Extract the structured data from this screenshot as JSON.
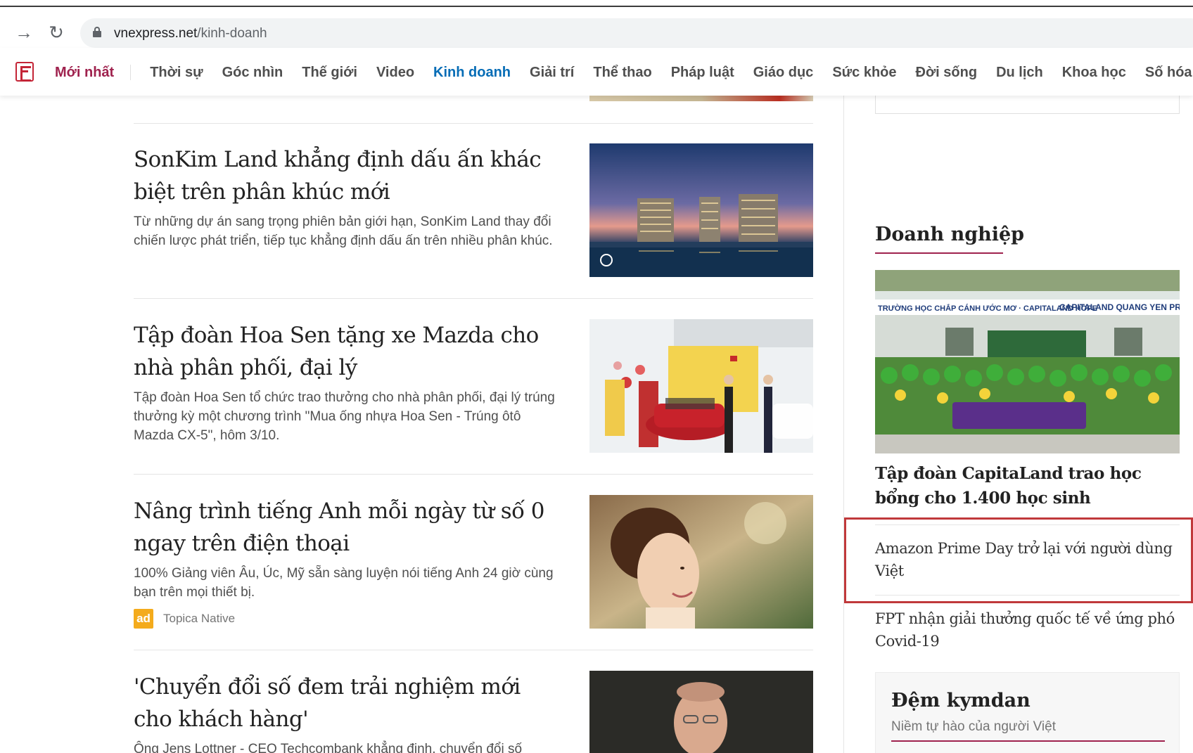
{
  "browser": {
    "url_domain": "vnexpress.net",
    "url_path": "/kinh-doanh"
  },
  "nav": {
    "latest": "Mới nhất",
    "items": [
      "Thời sự",
      "Góc nhìn",
      "Thế giới",
      "Video",
      "Kinh doanh",
      "Giải trí",
      "Thể thao",
      "Pháp luật",
      "Giáo dục",
      "Sức khỏe",
      "Đời sống",
      "Du lịch",
      "Khoa học",
      "Số hóa"
    ],
    "active_item": "Kinh doanh"
  },
  "articles": [
    {
      "title": "SonKim Land khẳng định dấu ấn khác biệt trên phân khúc mới",
      "description": "Từ những dự án sang trọng phiên bản giới hạn, SonKim Land thay đổi chiến lược phát triển, tiếp tục khẳng định dấu ấn trên nhiều phân khúc."
    },
    {
      "title": "Tập đoàn Hoa Sen tặng xe Mazda cho nhà phân phối, đại lý",
      "description": "Tập đoàn Hoa Sen tổ chức trao thưởng cho nhà phân phối, đại lý trúng thưởng kỳ một chương trình \"Mua ống nhựa Hoa Sen - Trúng ôtô Mazda CX-5\", hôm 3/10."
    },
    {
      "title": "Nâng trình tiếng Anh mỗi ngày từ số 0 ngay trên điện thoại",
      "description": "100% Giảng viên Âu, Úc, Mỹ sẵn sàng luyện nói tiếng Anh 24 giờ cùng bạn trên mọi thiết bị.",
      "ad_badge": "ad",
      "ad_source": "Topica Native"
    },
    {
      "title": "'Chuyển đổi số đem trải nghiệm mới cho khách hàng'",
      "description": "Ông Jens Lottner - CEO Techcombank khẳng định, chuyển đổi số"
    }
  ],
  "sidebar": {
    "heading": "Doanh nghiệp",
    "photo_banner_left": "TRƯỜNG HỌC CHẮP CÁNH ƯỚC MƠ · CAPITALAND HOPE",
    "photo_banner_right": "CAPITALAND QUANG YEN PRIM",
    "main_title": "Tập đoàn CapitaLand trao học bổng cho 1.400 học sinh",
    "links": [
      "Amazon Prime Day trở lại với người dùng Việt",
      "FPT nhận giải thưởng quốc tế về ứng phó Covid-19"
    ],
    "highlight_color": "#c0393b"
  },
  "promo": {
    "title": "Đệm kymdan",
    "subtitle": "Niềm tự hào của người Việt"
  },
  "colors": {
    "brand": "#9f224e",
    "active_nav": "#076db6",
    "ad_badge": "#f4ab1c"
  }
}
